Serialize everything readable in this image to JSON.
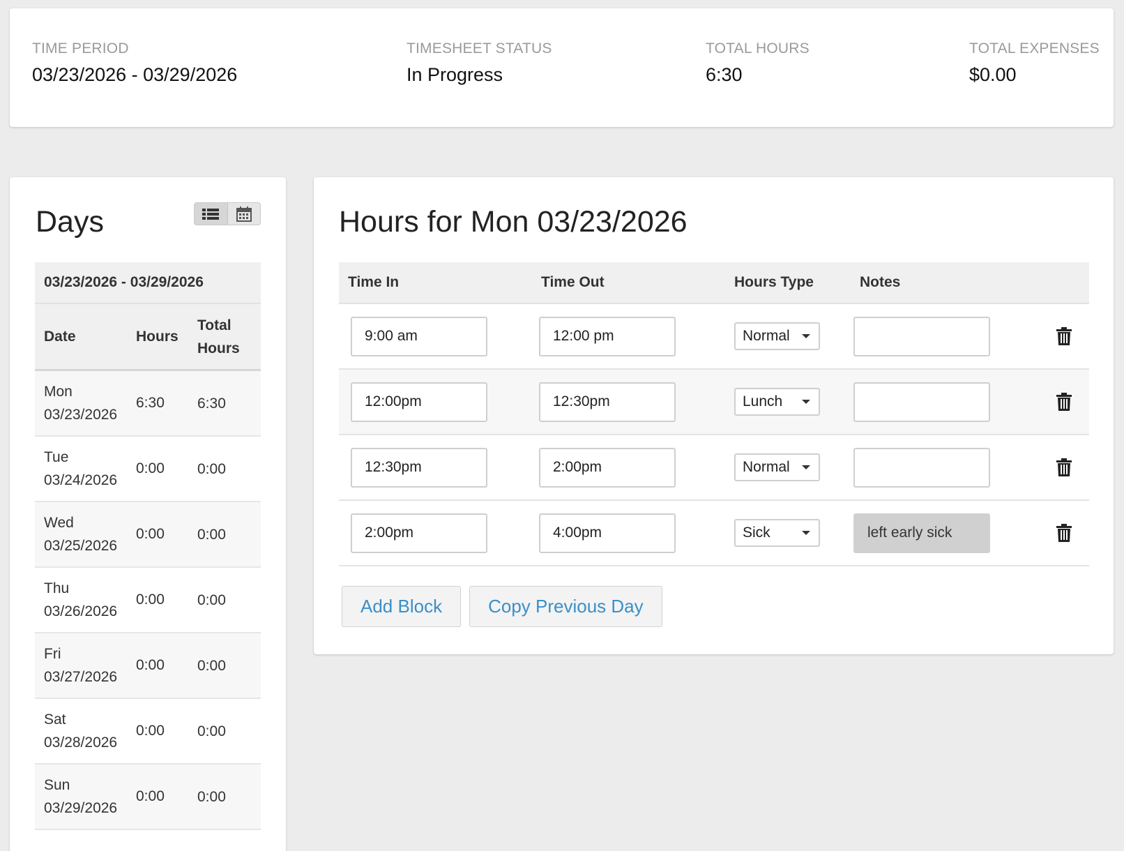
{
  "summary": {
    "time_period": {
      "label": "TIME PERIOD",
      "value": "03/23/2026 - 03/29/2026"
    },
    "status": {
      "label": "TIMESHEET STATUS",
      "value": "In Progress"
    },
    "total_hours": {
      "label": "TOTAL HOURS",
      "value": "6:30"
    },
    "total_expenses": {
      "label": "TOTAL EXPENSES",
      "value": "$0.00"
    }
  },
  "days_panel": {
    "title": "Days",
    "view_toggle": {
      "options": [
        "list-icon",
        "calendar-icon"
      ],
      "active": "list-icon"
    },
    "range": "03/23/2026 - 03/29/2026",
    "columns": {
      "date": "Date",
      "hours": "Hours",
      "total": "Total Hours"
    },
    "rows": [
      {
        "day": "Mon",
        "date": "03/23/2026",
        "hours": "6:30",
        "total": "6:30"
      },
      {
        "day": "Tue",
        "date": "03/24/2026",
        "hours": "0:00",
        "total": "0:00"
      },
      {
        "day": "Wed",
        "date": "03/25/2026",
        "hours": "0:00",
        "total": "0:00"
      },
      {
        "day": "Thu",
        "date": "03/26/2026",
        "hours": "0:00",
        "total": "0:00"
      },
      {
        "day": "Fri",
        "date": "03/27/2026",
        "hours": "0:00",
        "total": "0:00"
      },
      {
        "day": "Sat",
        "date": "03/28/2026",
        "hours": "0:00",
        "total": "0:00"
      },
      {
        "day": "Sun",
        "date": "03/29/2026",
        "hours": "0:00",
        "total": "0:00"
      }
    ]
  },
  "hours_panel": {
    "title": "Hours for Mon 03/23/2026",
    "columns": {
      "time_in": "Time In",
      "time_out": "Time Out",
      "hours_type": "Hours Type",
      "notes": "Notes"
    },
    "blocks": [
      {
        "time_in": "9:00 am",
        "time_out": "12:00 pm",
        "type": "Normal",
        "notes": ""
      },
      {
        "time_in": "12:00pm",
        "time_out": "12:30pm",
        "type": "Lunch",
        "notes": ""
      },
      {
        "time_in": "12:30pm",
        "time_out": "2:00pm",
        "type": "Normal",
        "notes": ""
      },
      {
        "time_in": "2:00pm",
        "time_out": "4:00pm",
        "type": "Sick",
        "notes": "left early sick"
      }
    ],
    "add_block_label": "Add Block",
    "copy_previous_label": "Copy Previous Day"
  },
  "colors": {
    "link": "#3a8fc8",
    "background": "#ececec",
    "header_bg": "#f0f0f0",
    "filled_note_bg": "#d0d0d0"
  }
}
